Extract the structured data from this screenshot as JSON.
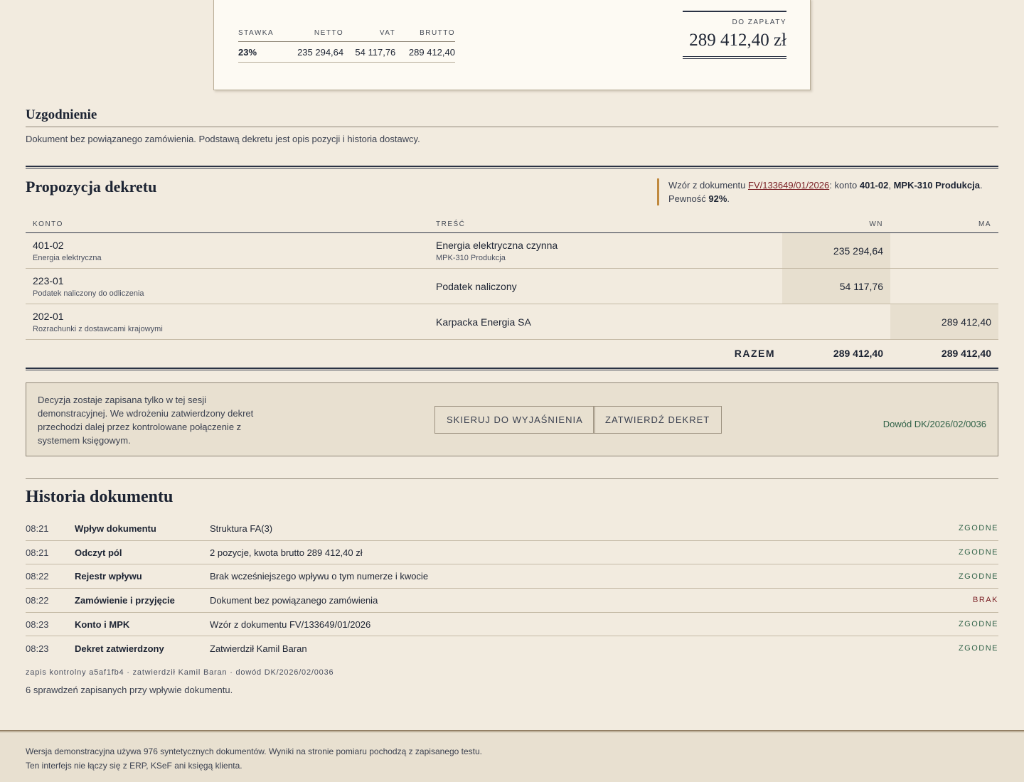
{
  "invoice": {
    "vat_headers": [
      "STAWKA",
      "NETTO",
      "VAT",
      "BRUTTO"
    ],
    "vat_row": {
      "rate": "23%",
      "net": "235 294,64",
      "vat": "54 117,76",
      "gross": "289 412,40"
    },
    "due_label": "DO ZAPŁATY",
    "due_value": "289 412,40 zł"
  },
  "reconciliation": {
    "title": "Uzgodnienie",
    "text": "Dokument bez powiązanego zamówienia. Podstawą dekretu jest opis pozycji i historia dostawcy."
  },
  "booking": {
    "title": "Propozycja dekretu",
    "pattern": {
      "prefix": "Wzór z dokumentu ",
      "doc_link": "FV/133649/01/2026",
      "mid": ": konto ",
      "account": "401-02",
      "sep": ", ",
      "cost_center": "MPK-310 Produkcja",
      "end": ".",
      "confidence_label": "Pewność ",
      "confidence": "92%",
      "confidence_end": "."
    },
    "headers": {
      "account": "KONTO",
      "desc": "TREŚĆ",
      "debit": "WN",
      "credit": "MA"
    },
    "rows": [
      {
        "account": "401-02",
        "account_name": "Energia elektryczna",
        "desc": "Energia elektryczna czynna",
        "desc_sub": "MPK-310 Produkcja",
        "debit": "235 294,64",
        "credit": ""
      },
      {
        "account": "223-01",
        "account_name": "Podatek naliczony do odliczenia",
        "desc": "Podatek naliczony",
        "desc_sub": "",
        "debit": "54 117,76",
        "credit": ""
      },
      {
        "account": "202-01",
        "account_name": "Rozrachunki z dostawcami krajowymi",
        "desc": "Karpacka Energia SA",
        "desc_sub": "",
        "debit": "",
        "credit": "289 412,40"
      }
    ],
    "total": {
      "label": "RAZEM",
      "debit": "289 412,40",
      "credit": "289 412,40"
    }
  },
  "decision": {
    "note": "Decyzja zostaje zapisana tylko w tej sesji demonstracyjnej. We wdrożeniu zatwierdzony dekret przechodzi dalej przez kontrolowane połączenie z systemem księgowym.",
    "explain_button": "SKIERUJ DO WYJAŚNIENIA",
    "approve_button": "ZATWIERDŹ DEKRET",
    "evidence": "Dowód DK/2026/02/0036"
  },
  "history": {
    "title": "Historia dokumentu",
    "rows": [
      {
        "time": "08:21",
        "event": "Wpływ dokumentu",
        "detail": "Struktura FA(3)",
        "status": "ZGODNE"
      },
      {
        "time": "08:21",
        "event": "Odczyt pól",
        "detail": "2 pozycje, kwota brutto 289 412,40 zł",
        "status": "ZGODNE"
      },
      {
        "time": "08:22",
        "event": "Rejestr wpływu",
        "detail": "Brak wcześniejszego wpływu o tym numerze i kwocie",
        "status": "ZGODNE"
      },
      {
        "time": "08:22",
        "event": "Zamówienie i przyjęcie",
        "detail": "Dokument bez powiązanego zamówienia",
        "status": "BRAK"
      },
      {
        "time": "08:23",
        "event": "Konto i MPK",
        "detail": "Wzór z dokumentu FV/133649/01/2026",
        "status": "ZGODNE"
      },
      {
        "time": "08:23",
        "event": "Dekret zatwierdzony",
        "detail": "Zatwierdził Kamil Baran",
        "status": "ZGODNE"
      }
    ],
    "audit": "zapis kontrolny a5af1fb4 · zatwierdził Kamil Baran · dowód DK/2026/02/0036",
    "checks": "6 sprawdzeń zapisanych przy wpływie dokumentu."
  },
  "footer": {
    "line1": "Wersja demonstracyjna używa 976 syntetycznych dokumentów. Wyniki na stronie pomiaru pochodzą z zapisanego testu.",
    "line2": "Ten interfejs nie łączy się z ERP, KSeF ani księgą klienta."
  },
  "colors": {
    "background": "#f2ebdf",
    "card": "#fdfaf3",
    "ink": "#1d2433",
    "accent_bar": "#c0893e",
    "status_ok": "#2f6147",
    "status_missing": "#7a1f24"
  }
}
